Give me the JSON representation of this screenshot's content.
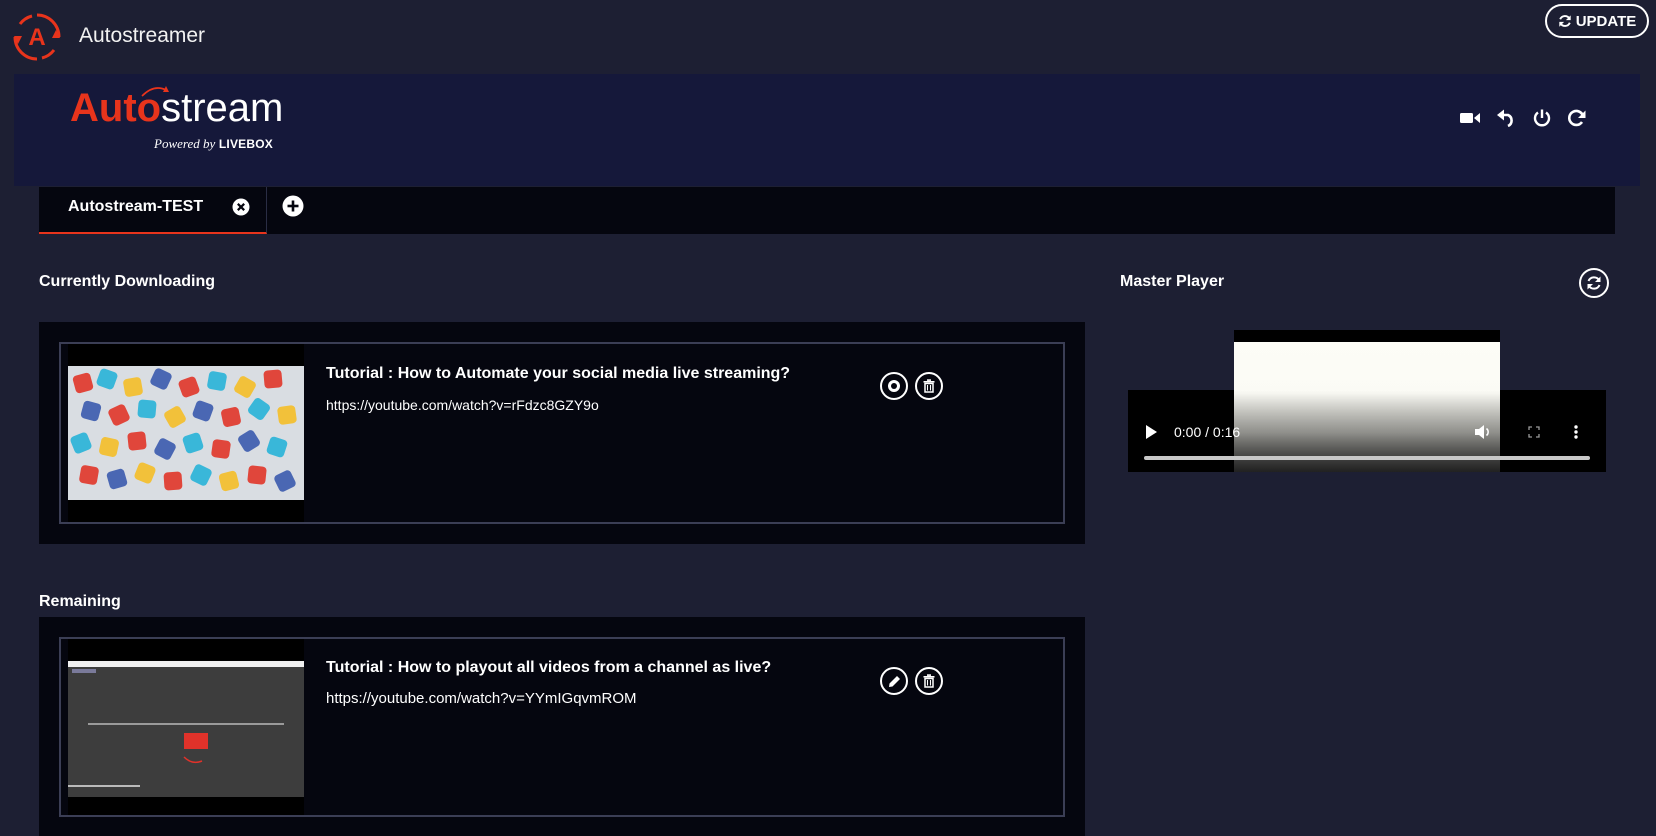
{
  "app": {
    "title": "Autostreamer",
    "update_label": "UPDATE",
    "logo_letter": "A"
  },
  "brand": {
    "name_red": "Auto",
    "name_white": "stream",
    "powered_by": "Powered by",
    "powered_brand": "LIVEBOX"
  },
  "header_icons": [
    "video-camera-icon",
    "undo-icon",
    "power-icon",
    "refresh-icon"
  ],
  "tabs": [
    {
      "label": "Autostream-TEST",
      "active": true
    }
  ],
  "sections": {
    "downloading": "Currently Downloading",
    "remaining": "Remaining",
    "master_player": "Master Player"
  },
  "downloading": [
    {
      "title": "Tutorial : How to Automate your social media live streaming?",
      "url": "https://youtube.com/watch?v=rFdzc8GZY9o"
    }
  ],
  "remaining": [
    {
      "title": "Tutorial : How to playout all videos from a channel as live?",
      "url": "https://youtube.com/watch?v=YYmIGqvmROM"
    }
  ],
  "player": {
    "time": "0:00 / 0:16",
    "progress": 0
  },
  "colors": {
    "accent": "#e8341c",
    "background": "#1d1f33",
    "banner": "#15183a",
    "panel": "#05060f"
  }
}
